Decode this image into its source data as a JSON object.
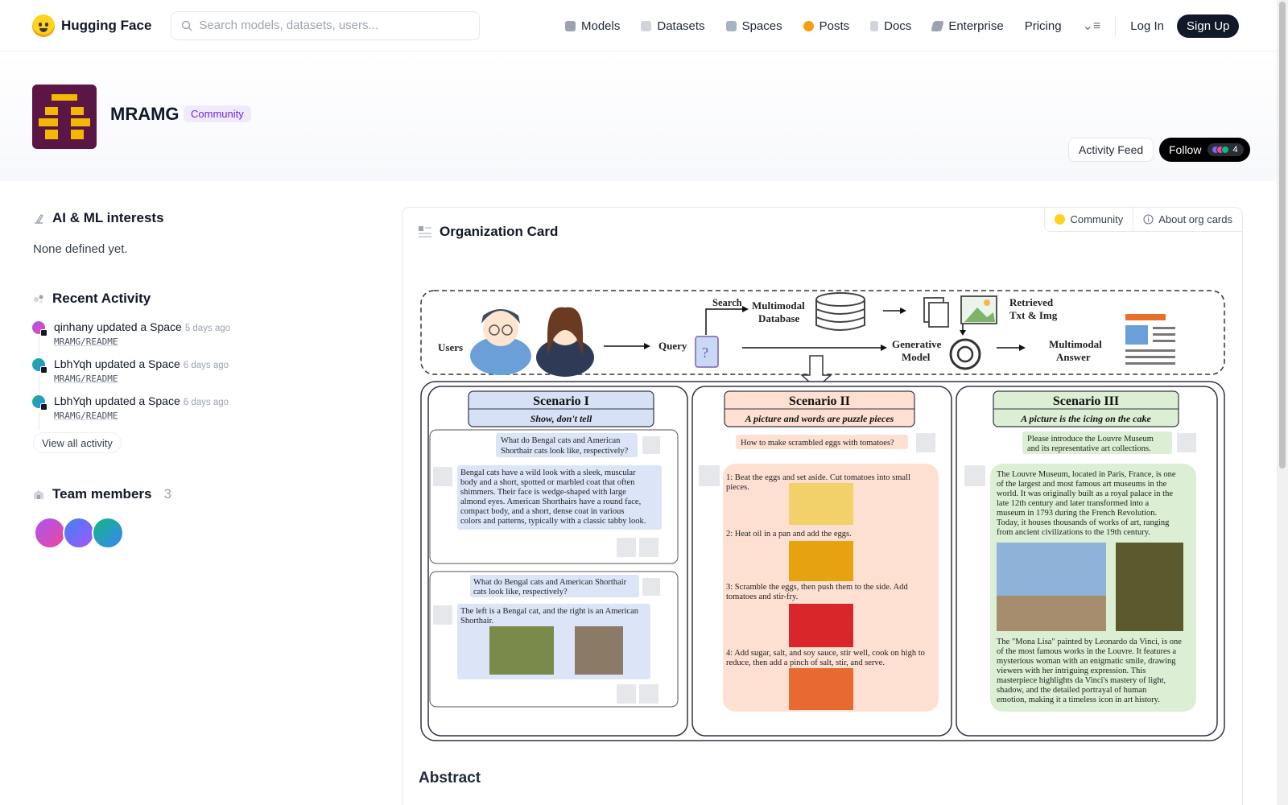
{
  "header": {
    "logo_text": "Hugging Face",
    "search_placeholder": "Search models, datasets, users...",
    "nav": [
      {
        "label": "Models",
        "icon": "models-icon",
        "color": "#9ca3af"
      },
      {
        "label": "Datasets",
        "icon": "datasets-icon",
        "color": "#d1d5db"
      },
      {
        "label": "Spaces",
        "icon": "spaces-icon",
        "color": "#9ca3af"
      },
      {
        "label": "Posts",
        "icon": "posts-icon",
        "color": "#f59e0b"
      },
      {
        "label": "Docs",
        "icon": "docs-icon",
        "color": "#d1d5db"
      },
      {
        "label": "Enterprise",
        "icon": "enterprise-icon",
        "color": "#9ca3af"
      },
      {
        "label": "Pricing"
      }
    ],
    "login": "Log In",
    "signup": "Sign Up"
  },
  "org": {
    "name": "MRAMG",
    "badge": "Community",
    "activity_feed": "Activity Feed",
    "follow": "Follow",
    "followers": "4",
    "avatar_color": "#5b1646",
    "avatar_pattern_color": "#f5b800"
  },
  "sidebar": {
    "interests_title": "AI & ML interests",
    "interests_value": "None defined yet.",
    "recent_title": "Recent Activity",
    "activities": [
      {
        "user": "qinhany",
        "action": "updated a Space",
        "time": "5 days ago",
        "link": "MRAMG/README",
        "color": "#c026d3"
      },
      {
        "user": "LbhYqh",
        "action": "updated a Space",
        "time": "6 days ago",
        "link": "MRAMG/README",
        "color": "#10b981"
      },
      {
        "user": "LbhYqh",
        "action": "updated a Space",
        "time": "6 days ago",
        "link": "MRAMG/README",
        "color": "#10b981"
      }
    ],
    "view_all": "View all activity",
    "team_title": "Team members",
    "team_count": "3"
  },
  "card": {
    "title": "Organization Card",
    "tab_community": "Community",
    "tab_about": "About org cards",
    "abstract_heading": "Abstract"
  },
  "figure": {
    "top": {
      "users": "Users",
      "query": "Query",
      "search": "Search",
      "database": [
        "Multimodal",
        "Database"
      ],
      "retrieved": [
        "Retrieved",
        "Txt & Img"
      ],
      "generative": [
        "Generative",
        "Model"
      ],
      "answer": [
        "Multimodal",
        "Answer"
      ]
    },
    "scenarios": [
      {
        "title": "Scenario I",
        "subtitle": "Show, don't tell",
        "q1": [
          "What do Bengal cats and American",
          "Shorthair cats look like, respectively?"
        ],
        "a1": [
          "Bengal cats have a wild look with a sleek, muscular",
          "body and a short, spotted or marbled coat that often",
          "shimmers. Their face is wedge-shaped with large",
          "almond eyes.  American Shorthairs have a round face,",
          "compact body, and a short, dense coat in various",
          "colors and patterns, typically with a classic tabby look."
        ],
        "q2": [
          "What do Bengal cats and American Shorthair",
          "cats look like, respectively?"
        ],
        "a2": [
          "The left is a Bengal cat, and the right is an American",
          "Shorthair."
        ]
      },
      {
        "title": "Scenario II",
        "subtitle": "A picture and words are puzzle pieces",
        "q": "How to make scrambled eggs with tomatoes?",
        "steps": [
          [
            "1: Beat the eggs and set aside. Cut tomatoes into small",
            "pieces."
          ],
          [
            "2: Heat oil in a pan and add the eggs."
          ],
          [
            "3: Scramble the eggs, then push them to the side. Add",
            "tomatoes and stir-fry."
          ],
          [
            "4: Add sugar, salt, and soy sauce, stir well, cook on high to",
            "reduce, then add a pinch of salt, stir, and serve."
          ]
        ]
      },
      {
        "title": "Scenario III",
        "subtitle": "A picture is the icing on the cake",
        "q": [
          "Please introduce the Louvre Museum",
          "and its representative art collections."
        ],
        "a1": [
          "The Louvre Museum, located in Paris, France, is one",
          "of the largest and most famous art museums in the",
          "world. It was originally built as a royal palace in the",
          "late 12th century and later transformed into a",
          "museum in 1793 during the French Revolution.",
          "Today, it houses thousands of works of art, ranging",
          "from ancient civilizations to the 19th century."
        ],
        "a2": [
          "The \"Mona Lisa\" painted by Leonardo da Vinci, is one",
          "of the most famous works in the Louvre. It features a",
          "mysterious woman with an enigmatic smile, drawing",
          "viewers with her intriguing expression. This",
          "masterpiece highlights da Vinci's mastery of light,",
          "shadow, and the detailed portrayal of human",
          "emotion, making it a timeless icon in art history."
        ]
      }
    ]
  }
}
